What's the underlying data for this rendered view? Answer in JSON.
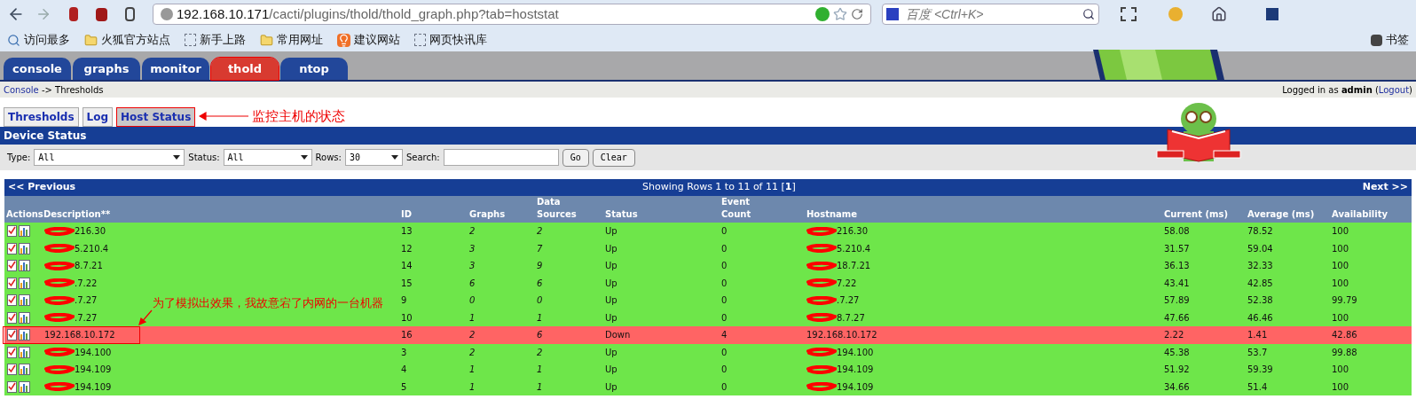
{
  "browser": {
    "url": {
      "host": "192.168.10.171",
      "path": "/cacti/plugins/thold/thold_graph.php?tab=hoststat"
    },
    "search_placeholder": "百度 <Ctrl+K>",
    "bookmarks": [
      {
        "label": "访问最多",
        "kind": "search"
      },
      {
        "label": "火狐官方站点",
        "kind": "folder"
      },
      {
        "label": "新手上路",
        "kind": "dashed"
      },
      {
        "label": "常用网址",
        "kind": "folder"
      },
      {
        "label": "建议网站",
        "kind": "bulb"
      },
      {
        "label": "网页快讯库",
        "kind": "dashed"
      }
    ],
    "bookmarks_menu": "书签"
  },
  "nav_tabs": [
    {
      "label": "console",
      "selected": false
    },
    {
      "label": "graphs",
      "selected": false
    },
    {
      "label": "monitor",
      "selected": false
    },
    {
      "label": "thold",
      "selected": true
    },
    {
      "label": "ntop",
      "selected": false
    }
  ],
  "breadcrumb": {
    "link": "Console",
    "rest": "-> Thresholds"
  },
  "login": {
    "prefix": "Logged in as",
    "user": "admin",
    "paren_open": "(",
    "logout": "Logout",
    "paren_close": ")"
  },
  "sub_tabs": [
    {
      "label": "Thresholds",
      "selected": false
    },
    {
      "label": "Log",
      "selected": false
    },
    {
      "label": "Host Status",
      "selected": true
    }
  ],
  "annotation_tabs": "监控主机的状态",
  "section_title": "Device Status",
  "filters": {
    "type_label": "Type:",
    "type_value": "All",
    "status_label": "Status:",
    "status_value": "All",
    "rows_label": "Rows:",
    "rows_value": "30",
    "search_label": "Search:",
    "go": "Go",
    "clear": "Clear"
  },
  "pager": {
    "previous": "<< Previous",
    "info": "Showing Rows 1 to 11 of 11 [**1**]",
    "next": "Next >>"
  },
  "table": {
    "columns": [
      "Actions",
      "Description**",
      "ID",
      "Graphs",
      "Data Sources",
      "Status",
      "Event Count",
      "Hostname",
      "Current (ms)",
      "Average (ms)",
      "Availability"
    ],
    "rows": [
      {
        "description": "216.30",
        "id": "13",
        "graphs": "2",
        "data_sources": "2",
        "status": "Up",
        "kind": "up",
        "event_count": "0",
        "hostname": "216.30",
        "current": "58.08",
        "average": "78.52",
        "availability": "100"
      },
      {
        "description": "5.210.4",
        "id": "12",
        "graphs": "3",
        "data_sources": "7",
        "status": "Up",
        "kind": "up",
        "event_count": "0",
        "hostname": "5.210.4",
        "current": "31.57",
        "average": "59.04",
        "availability": "100"
      },
      {
        "description": "8.7.21",
        "id": "14",
        "graphs": "3",
        "data_sources": "9",
        "status": "Up",
        "kind": "up",
        "event_count": "0",
        "hostname": "18.7.21",
        "current": "36.13",
        "average": "32.33",
        "availability": "100"
      },
      {
        "description": ".7.22",
        "id": "15",
        "graphs": "6",
        "data_sources": "6",
        "status": "Up",
        "kind": "up",
        "event_count": "0",
        "hostname": "7.22",
        "current": "43.41",
        "average": "42.85",
        "availability": "100"
      },
      {
        "description": ".7.27",
        "id": "9",
        "graphs": "0",
        "data_sources": "0",
        "status": "Up",
        "kind": "up",
        "event_count": "0",
        "hostname": ".7.27",
        "current": "57.89",
        "average": "52.38",
        "availability": "99.79"
      },
      {
        "description": ".7.27",
        "id": "10",
        "graphs": "1",
        "data_sources": "1",
        "status": "Up",
        "kind": "up",
        "event_count": "0",
        "hostname": "8.7.27",
        "current": "47.66",
        "average": "46.46",
        "availability": "100"
      },
      {
        "description": "192.168.10.172",
        "id": "16",
        "graphs": "2",
        "data_sources": "6",
        "status": "Down",
        "kind": "down",
        "event_count": "4",
        "hostname": "192.168.10.172",
        "current": "2.22",
        "average": "1.41",
        "availability": "42.86"
      },
      {
        "description": "194.100",
        "id": "3",
        "graphs": "2",
        "data_sources": "2",
        "status": "Up",
        "kind": "up",
        "event_count": "0",
        "hostname": "194.100",
        "current": "45.38",
        "average": "53.7",
        "availability": "99.88"
      },
      {
        "description": "194.109",
        "id": "4",
        "graphs": "1",
        "data_sources": "1",
        "status": "Up",
        "kind": "up",
        "event_count": "0",
        "hostname": "194.109",
        "current": "51.92",
        "average": "59.39",
        "availability": "100"
      },
      {
        "description": "194.109",
        "id": "5",
        "graphs": "1",
        "data_sources": "1",
        "status": "Up",
        "kind": "up",
        "event_count": "0",
        "hostname": "194.109",
        "current": "34.66",
        "average": "51.4",
        "availability": "100"
      }
    ]
  },
  "annotation_row": "为了模拟出效果，我故意宕了内网的一台机器"
}
